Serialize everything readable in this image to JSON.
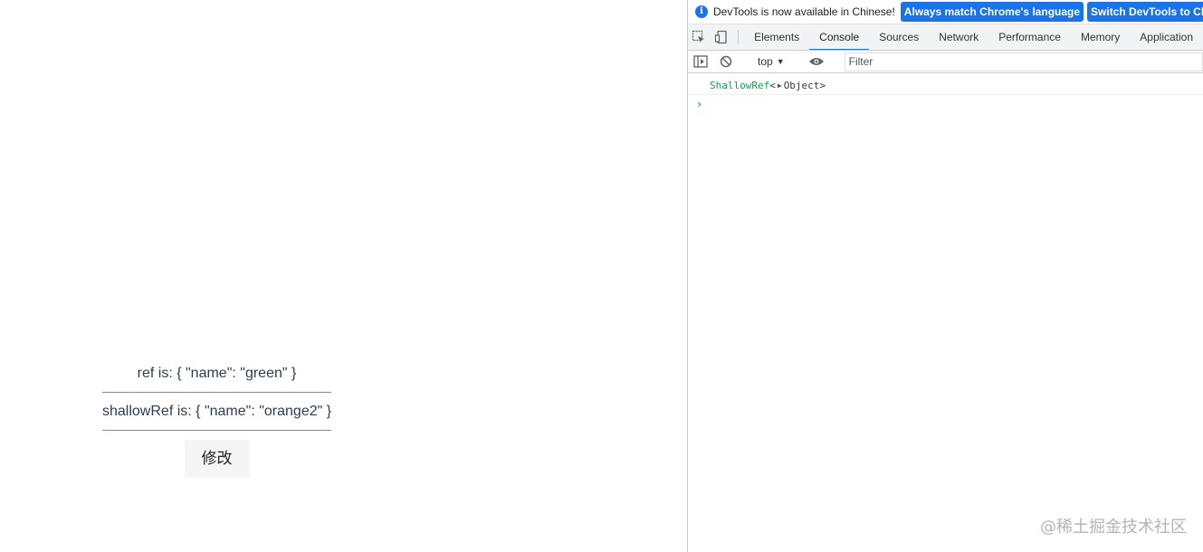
{
  "app": {
    "ref_text": "ref is: { \"name\": \"green\" }",
    "shallow_text": "shallowRef is: { \"name\": \"orange2\" }",
    "edit_button": "修改"
  },
  "devtools": {
    "infobar": {
      "message": "DevTools is now available in Chinese!",
      "btn_match": "Always match Chrome's language",
      "btn_switch": "Switch DevTools to Chinese"
    },
    "tabs": [
      "Elements",
      "Console",
      "Sources",
      "Network",
      "Performance",
      "Memory",
      "Application"
    ],
    "active_tab": "Console",
    "toolbar": {
      "context": "top",
      "filter_placeholder": "Filter"
    },
    "console": {
      "log_name": "ShallowRef",
      "log_open": "<",
      "log_object": "Object",
      "log_close": ">",
      "prompt": "›"
    }
  },
  "watermark": "@稀土掘金技术社区",
  "colors": {
    "accent": "#1a73e8",
    "log_name": "#1a9a4e"
  }
}
